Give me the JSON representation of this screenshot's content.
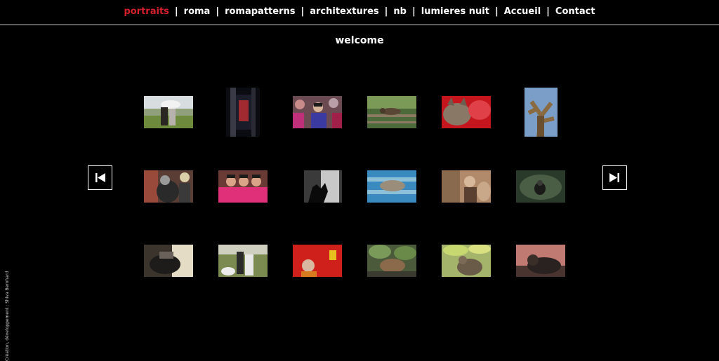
{
  "nav": {
    "items": [
      {
        "label": "portraits",
        "active": true
      },
      {
        "label": "roma"
      },
      {
        "label": "romapatterns"
      },
      {
        "label": "architextures"
      },
      {
        "label": "nb"
      },
      {
        "label": "lumieres nuit"
      },
      {
        "label": "Accueil"
      },
      {
        "label": "Contact"
      }
    ],
    "separator": "|",
    "active_color": "#d51f2b"
  },
  "page": {
    "title": "welcome",
    "credit": "Création, développement : Shiva Bernhard"
  },
  "gallery": {
    "prev_icon": "skip-previous-icon",
    "next_icon": "skip-next-icon",
    "thumbnails": [
      {
        "subject": "couple with white umbrella outdoors"
      },
      {
        "subject": "person in red-lit doorway"
      },
      {
        "subject": "young man in crowd"
      },
      {
        "subject": "cat resting on a fence in greenery"
      },
      {
        "subject": "tabby cat on red cushion"
      },
      {
        "subject": "bare tree branches against sky"
      },
      {
        "subject": "person in costume with mask"
      },
      {
        "subject": "girls in pink traditional dress"
      },
      {
        "subject": "silhouette by window"
      },
      {
        "subject": "cat sleeping on blue bench"
      },
      {
        "subject": "man among plants, sepia"
      },
      {
        "subject": "figure in dark forest"
      },
      {
        "subject": "still life on table"
      },
      {
        "subject": "couple walking on a path"
      },
      {
        "subject": "man in front of red lanterns"
      },
      {
        "subject": "cat among leaves"
      },
      {
        "subject": "cat near green leaves"
      },
      {
        "subject": "cat lying down"
      }
    ]
  }
}
